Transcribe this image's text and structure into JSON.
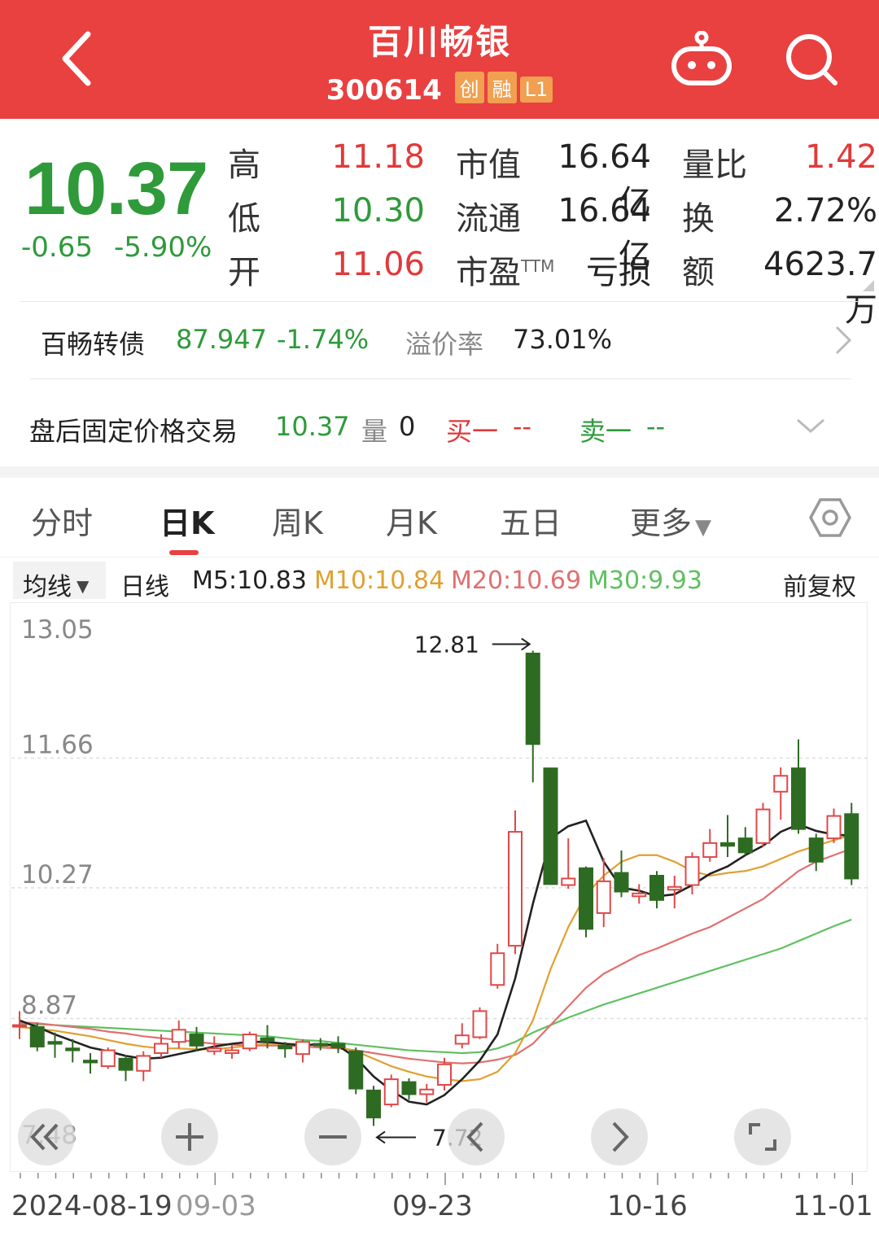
{
  "header": {
    "title": "百川畅银",
    "code": "300614",
    "badges": [
      "创",
      "融",
      "L1"
    ],
    "colors": {
      "bar": "#e94040",
      "badge": "#f0a050"
    }
  },
  "quote": {
    "price": "10.37",
    "change": "-0.65",
    "change_pct": "-5.90%",
    "stats": [
      {
        "label": "高",
        "value": "11.18",
        "tone": "red"
      },
      {
        "label": "低",
        "value": "10.30",
        "tone": "green"
      },
      {
        "label": "开",
        "value": "11.06",
        "tone": "red"
      },
      {
        "label": "市值",
        "value": "16.64亿",
        "tone": "dark"
      },
      {
        "label": "流通",
        "value": "16.64亿",
        "tone": "dark"
      },
      {
        "label": "市盈",
        "label_sup": "TTM",
        "value": "亏损",
        "tone": "dark"
      },
      {
        "label": "量比",
        "value": "1.42",
        "tone": "red"
      },
      {
        "label": "换",
        "value": "2.72%",
        "tone": "dark"
      },
      {
        "label": "额",
        "value": "4623.7万",
        "tone": "dark"
      }
    ]
  },
  "convertible": {
    "name": "百畅转债",
    "price": "87.947",
    "change_pct": "-1.74%",
    "premium_label": "溢价率",
    "premium": "73.01%"
  },
  "after_hours": {
    "label": "盘后固定价格交易",
    "price": "10.37",
    "volume_label": "量",
    "volume": "0",
    "buy_label": "买一",
    "buy_value": "--",
    "sell_label": "卖一",
    "sell_value": "--"
  },
  "tabs": [
    "分时",
    "日K",
    "周K",
    "月K",
    "五日",
    "更多"
  ],
  "active_tab": "日K",
  "ma_bar": {
    "dropdown": "均线",
    "period": "日线",
    "m5": "M5:10.83",
    "m10": "M10:10.84",
    "m20": "M20:10.69",
    "m30": "M30:9.93",
    "adjust": "前复权",
    "colors": {
      "m5": "#222222",
      "m10": "#e0a030",
      "m20": "#e07070",
      "m30": "#60c060"
    }
  },
  "chart_data": {
    "type": "candlestick",
    "y_ticks": [
      "13.05",
      "11.66",
      "10.27",
      "8.87",
      "7.48"
    ],
    "ylim": [
      7.48,
      13.05
    ],
    "x_labels": [
      "2024-08-19",
      "09-03",
      "09-23",
      "10-16",
      "11-01"
    ],
    "annotations": [
      {
        "text": "12.81",
        "arrow": "right"
      },
      {
        "text": "7.72",
        "arrow": "left"
      }
    ],
    "candles": [
      {
        "o": 8.8,
        "c": 8.8,
        "h": 8.95,
        "l": 8.65
      },
      {
        "o": 8.78,
        "c": 8.57,
        "h": 8.82,
        "l": 8.52
      },
      {
        "o": 8.62,
        "c": 8.6,
        "h": 8.72,
        "l": 8.45
      },
      {
        "o": 8.55,
        "c": 8.53,
        "h": 8.65,
        "l": 8.4
      },
      {
        "o": 8.42,
        "c": 8.4,
        "h": 8.5,
        "l": 8.28
      },
      {
        "o": 8.36,
        "c": 8.53,
        "h": 8.56,
        "l": 8.33
      },
      {
        "o": 8.44,
        "c": 8.32,
        "h": 8.48,
        "l": 8.2
      },
      {
        "o": 8.31,
        "c": 8.47,
        "h": 8.52,
        "l": 8.2
      },
      {
        "o": 8.5,
        "c": 8.6,
        "h": 8.7,
        "l": 8.45
      },
      {
        "o": 8.62,
        "c": 8.75,
        "h": 8.85,
        "l": 8.55
      },
      {
        "o": 8.7,
        "c": 8.58,
        "h": 8.78,
        "l": 8.52
      },
      {
        "o": 8.52,
        "c": 8.55,
        "h": 8.68,
        "l": 8.48
      },
      {
        "o": 8.5,
        "c": 8.53,
        "h": 8.58,
        "l": 8.44
      },
      {
        "o": 8.55,
        "c": 8.7,
        "h": 8.73,
        "l": 8.52
      },
      {
        "o": 8.66,
        "c": 8.63,
        "h": 8.8,
        "l": 8.55
      },
      {
        "o": 8.58,
        "c": 8.55,
        "h": 8.62,
        "l": 8.45
      },
      {
        "o": 8.49,
        "c": 8.62,
        "h": 8.65,
        "l": 8.4
      },
      {
        "o": 8.6,
        "c": 8.58,
        "h": 8.66,
        "l": 8.53
      },
      {
        "o": 8.6,
        "c": 8.56,
        "h": 8.68,
        "l": 8.5
      },
      {
        "o": 8.52,
        "c": 8.12,
        "h": 8.56,
        "l": 8.06
      },
      {
        "o": 8.1,
        "c": 7.81,
        "h": 8.15,
        "l": 7.72
      },
      {
        "o": 7.95,
        "c": 8.22,
        "h": 8.27,
        "l": 7.92
      },
      {
        "o": 8.19,
        "c": 8.06,
        "h": 8.23,
        "l": 8.0
      },
      {
        "o": 8.06,
        "c": 8.11,
        "h": 8.17,
        "l": 7.97
      },
      {
        "o": 8.16,
        "c": 8.38,
        "h": 8.45,
        "l": 8.1
      },
      {
        "o": 8.6,
        "c": 8.69,
        "h": 8.82,
        "l": 8.55
      },
      {
        "o": 8.67,
        "c": 8.95,
        "h": 8.99,
        "l": 8.65
      },
      {
        "o": 9.23,
        "c": 9.57,
        "h": 9.67,
        "l": 9.19
      },
      {
        "o": 9.65,
        "c": 10.87,
        "h": 11.1,
        "l": 9.56
      },
      {
        "o": 12.78,
        "c": 11.81,
        "h": 12.81,
        "l": 11.4
      },
      {
        "o": 11.55,
        "c": 10.31,
        "h": 11.55,
        "l": 10.31
      },
      {
        "o": 10.3,
        "c": 10.37,
        "h": 10.8,
        "l": 10.26
      },
      {
        "o": 10.48,
        "c": 9.83,
        "h": 10.5,
        "l": 9.74
      },
      {
        "o": 10.0,
        "c": 10.34,
        "h": 10.59,
        "l": 9.85
      },
      {
        "o": 10.43,
        "c": 10.23,
        "h": 10.67,
        "l": 10.17
      },
      {
        "o": 10.18,
        "c": 10.21,
        "h": 10.31,
        "l": 10.1
      },
      {
        "o": 10.4,
        "c": 10.14,
        "h": 10.45,
        "l": 10.05
      },
      {
        "o": 10.25,
        "c": 10.28,
        "h": 10.4,
        "l": 10.05
      },
      {
        "o": 10.3,
        "c": 10.6,
        "h": 10.65,
        "l": 10.2
      },
      {
        "o": 10.6,
        "c": 10.75,
        "h": 10.9,
        "l": 10.55
      },
      {
        "o": 10.75,
        "c": 10.72,
        "h": 11.05,
        "l": 10.6
      },
      {
        "o": 10.8,
        "c": 10.65,
        "h": 10.92,
        "l": 10.62
      },
      {
        "o": 10.75,
        "c": 11.11,
        "h": 11.18,
        "l": 10.71
      },
      {
        "o": 11.3,
        "c": 11.47,
        "h": 11.56,
        "l": 11.0
      },
      {
        "o": 11.55,
        "c": 10.9,
        "h": 11.86,
        "l": 10.85
      },
      {
        "o": 10.8,
        "c": 10.55,
        "h": 10.85,
        "l": 10.45
      },
      {
        "o": 10.8,
        "c": 11.04,
        "h": 11.12,
        "l": 10.75
      },
      {
        "o": 11.06,
        "c": 10.37,
        "h": 11.18,
        "l": 10.3
      }
    ],
    "ma5": [
      8.85,
      8.78,
      8.7,
      8.63,
      8.56,
      8.52,
      8.47,
      8.44,
      8.45,
      8.49,
      8.53,
      8.57,
      8.6,
      8.62,
      8.62,
      8.6,
      8.58,
      8.6,
      8.58,
      8.45,
      8.25,
      8.1,
      7.98,
      7.95,
      8.05,
      8.22,
      8.42,
      8.7,
      9.3,
      10.1,
      10.8,
      10.93,
      10.99,
      10.55,
      10.27,
      10.24,
      10.18,
      10.2,
      10.3,
      10.42,
      10.5,
      10.62,
      10.72,
      10.87,
      10.95,
      10.88,
      10.84,
      10.83
    ],
    "ma10": [
      8.78,
      8.76,
      8.74,
      8.71,
      8.68,
      8.64,
      8.6,
      8.57,
      8.55,
      8.55,
      8.54,
      8.54,
      8.56,
      8.58,
      8.6,
      8.6,
      8.6,
      8.58,
      8.57,
      8.52,
      8.44,
      8.36,
      8.3,
      8.25,
      8.22,
      8.2,
      8.22,
      8.3,
      8.5,
      8.85,
      9.4,
      9.85,
      10.2,
      10.4,
      10.55,
      10.62,
      10.62,
      10.55,
      10.45,
      10.4,
      10.43,
      10.45,
      10.5,
      10.58,
      10.66,
      10.72,
      10.78,
      10.84
    ],
    "ma20": [
      8.83,
      8.82,
      8.8,
      8.78,
      8.76,
      8.73,
      8.71,
      8.68,
      8.66,
      8.64,
      8.62,
      8.6,
      8.59,
      8.58,
      8.58,
      8.58,
      8.57,
      8.56,
      8.55,
      8.53,
      8.5,
      8.47,
      8.44,
      8.42,
      8.4,
      8.39,
      8.4,
      8.43,
      8.48,
      8.6,
      8.8,
      9.0,
      9.2,
      9.35,
      9.45,
      9.55,
      9.62,
      9.7,
      9.78,
      9.85,
      9.95,
      10.05,
      10.15,
      10.3,
      10.45,
      10.55,
      10.62,
      10.69
    ],
    "ma30": [
      8.82,
      8.81,
      8.8,
      8.79,
      8.78,
      8.77,
      8.76,
      8.75,
      8.74,
      8.73,
      8.72,
      8.71,
      8.7,
      8.69,
      8.68,
      8.66,
      8.64,
      8.63,
      8.61,
      8.59,
      8.57,
      8.55,
      8.53,
      8.52,
      8.51,
      8.5,
      8.51,
      8.55,
      8.62,
      8.72,
      8.8,
      8.88,
      8.95,
      9.02,
      9.08,
      9.14,
      9.2,
      9.26,
      9.32,
      9.38,
      9.44,
      9.5,
      9.56,
      9.62,
      9.7,
      9.78,
      9.86,
      9.93
    ],
    "colors": {
      "up": "#e04848",
      "down": "#2e6b22"
    }
  }
}
